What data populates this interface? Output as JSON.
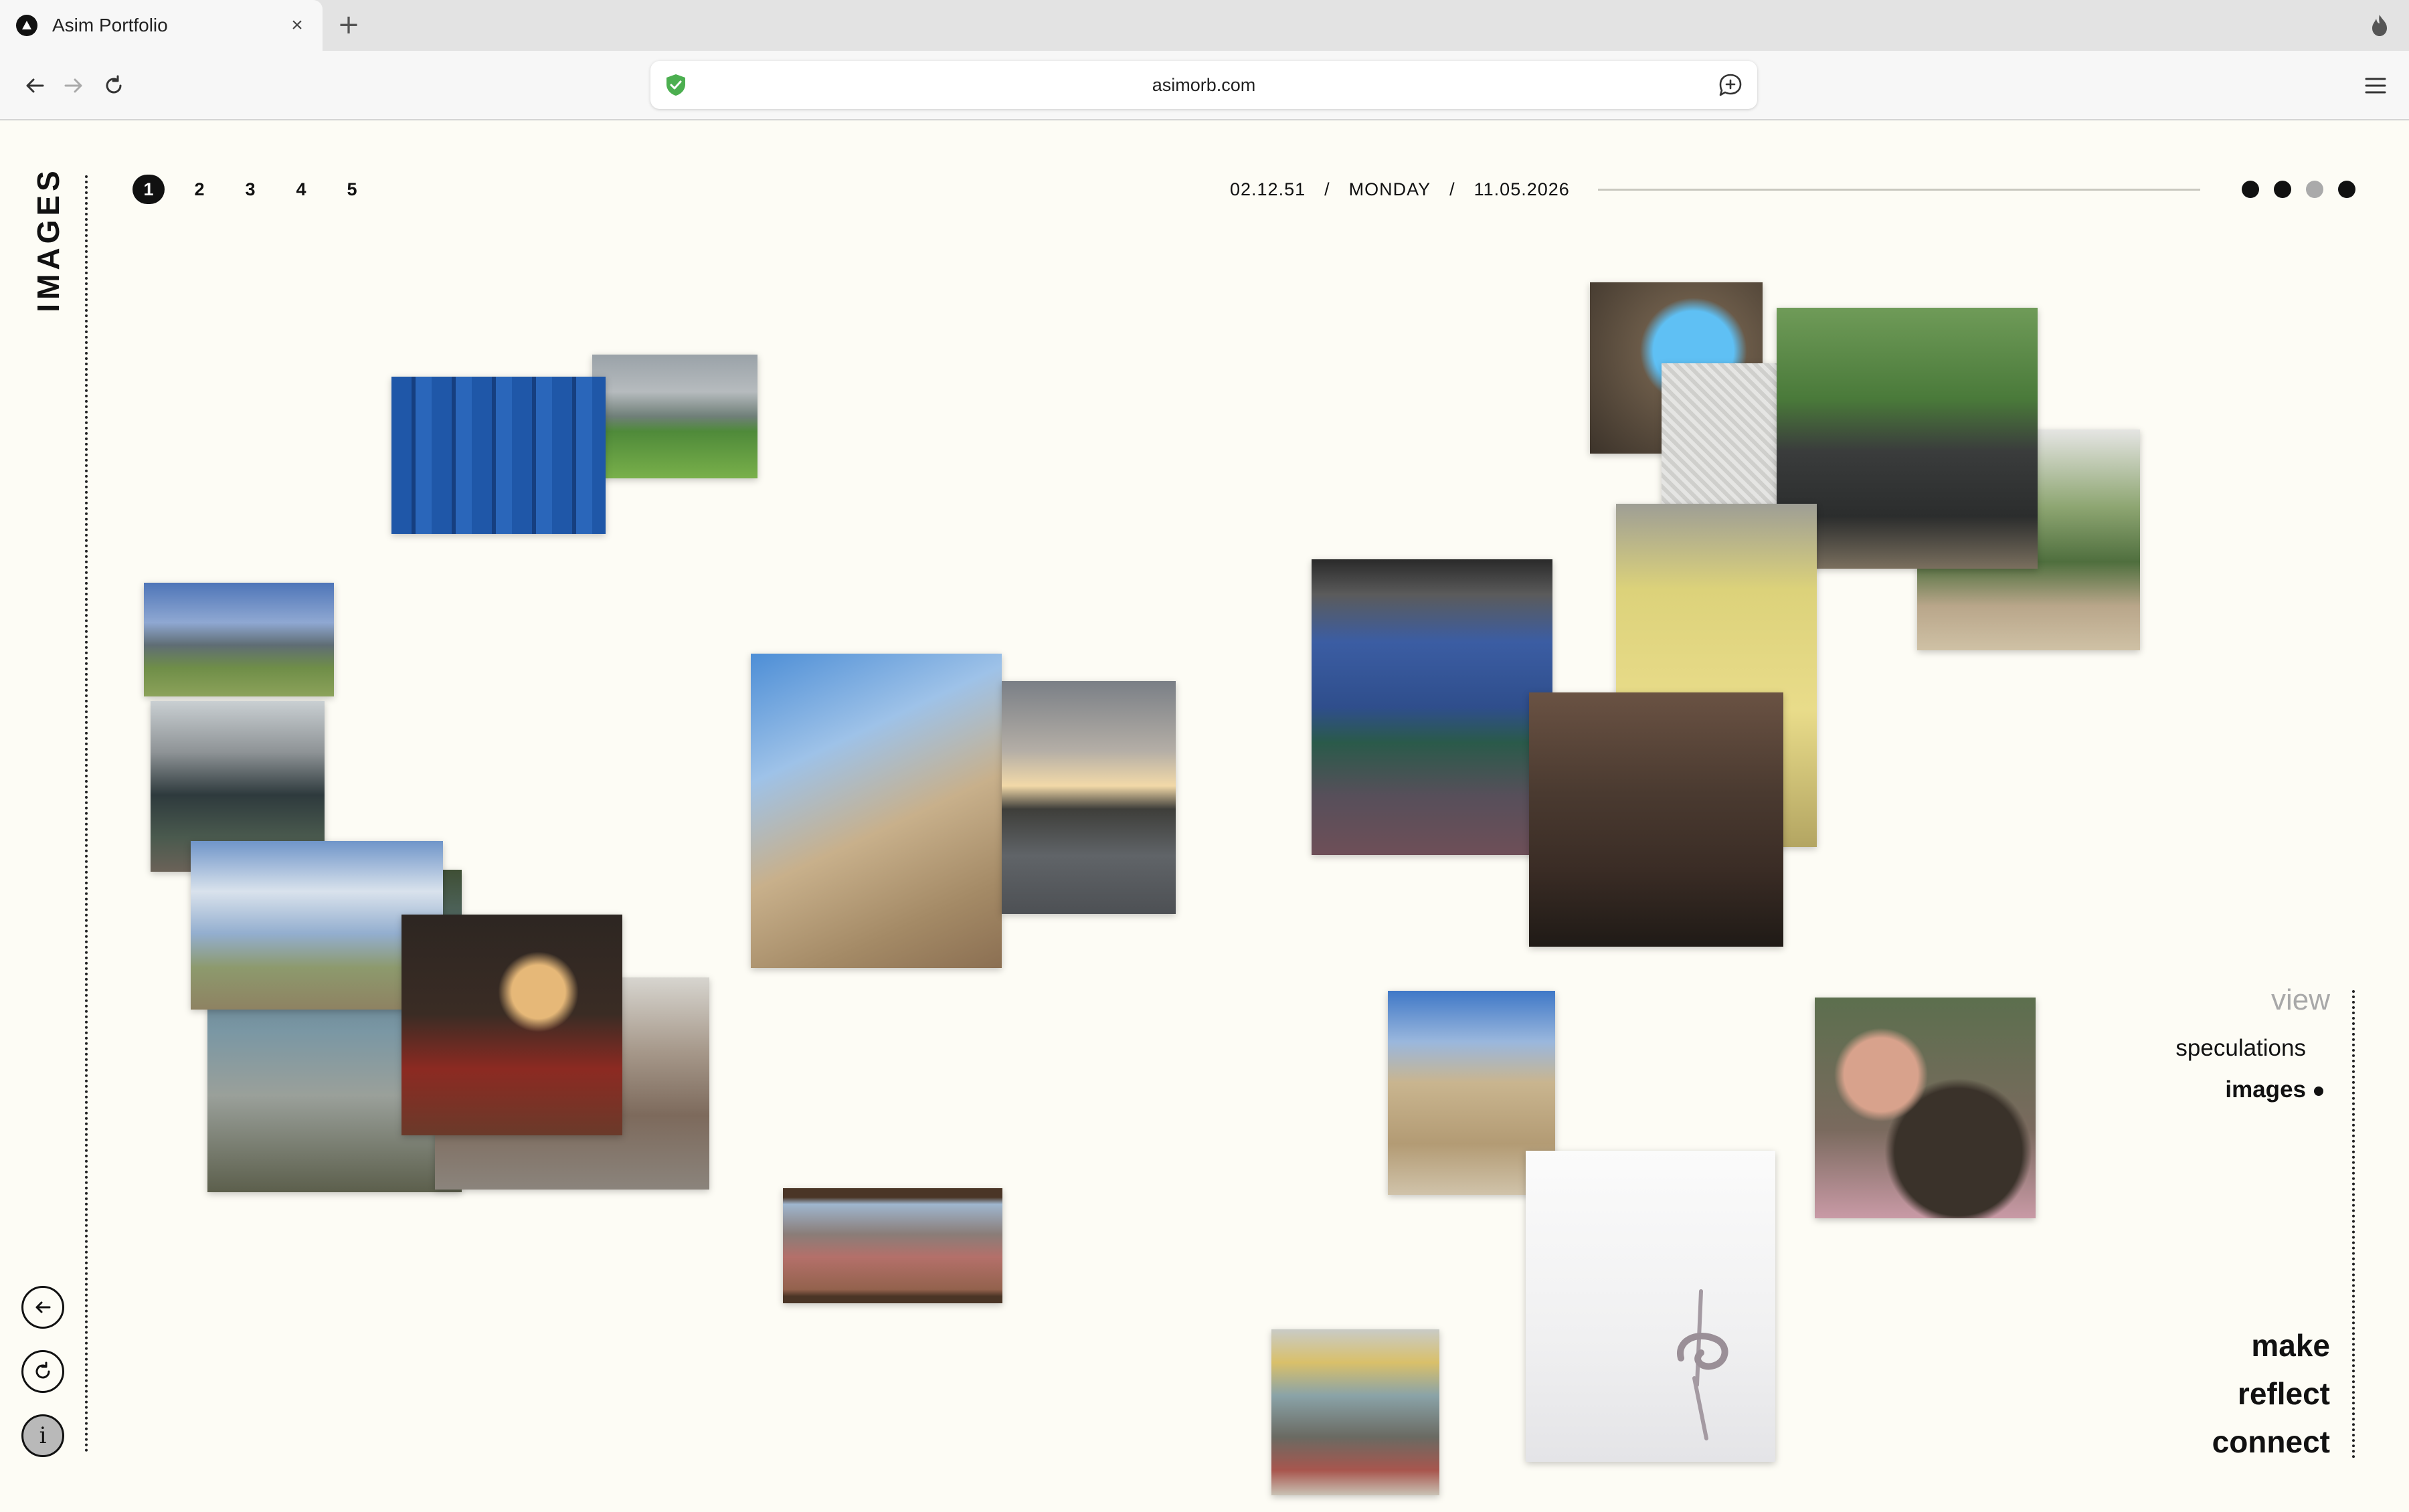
{
  "browser": {
    "tab_title": "Asim Portfolio",
    "tab_close": "×",
    "new_tab": "+",
    "url": "asimorb.com"
  },
  "page": {
    "side_title": "IMAGES",
    "pagination": [
      "1",
      "2",
      "3",
      "4",
      "5"
    ],
    "active_page": "1",
    "date": {
      "left": "02.12.51",
      "separator": "/",
      "weekday": "MONDAY",
      "right": "11.05.2026"
    },
    "indicator_dots": [
      "filled",
      "filled",
      "grey",
      "filled"
    ],
    "view_nav": {
      "label": "view",
      "items": [
        "speculations",
        "images"
      ]
    },
    "actions": [
      "make",
      "reflect",
      "connect"
    ],
    "info_glyph": "i"
  },
  "colors": {
    "background": "#fdfcf5",
    "ink": "#111111",
    "muted": "#a8a8a8",
    "shield_green": "#4caf50"
  },
  "photos": [
    {
      "name": "photo-blue-shipping-container"
    },
    {
      "name": "photo-alpine-meadow"
    },
    {
      "name": "photo-mountain-church"
    },
    {
      "name": "photo-market-stall"
    },
    {
      "name": "photo-pasture-sky"
    },
    {
      "name": "photo-lake-shore"
    },
    {
      "name": "photo-red-armchair-room"
    },
    {
      "name": "photo-old-town-street"
    },
    {
      "name": "photo-stone-building"
    },
    {
      "name": "photo-sunset-water"
    },
    {
      "name": "photo-framed-window-view"
    },
    {
      "name": "photo-cave-opening"
    },
    {
      "name": "photo-white-texture"
    },
    {
      "name": "photo-statue-park"
    },
    {
      "name": "photo-stone-stairs"
    },
    {
      "name": "photo-yellow-facade"
    },
    {
      "name": "photo-fri-assange-sign"
    },
    {
      "name": "photo-jazz-band"
    },
    {
      "name": "photo-stone-alley"
    },
    {
      "name": "photo-man-with-dog"
    },
    {
      "name": "photo-white-sculpture"
    },
    {
      "name": "photo-cafeteria"
    }
  ]
}
